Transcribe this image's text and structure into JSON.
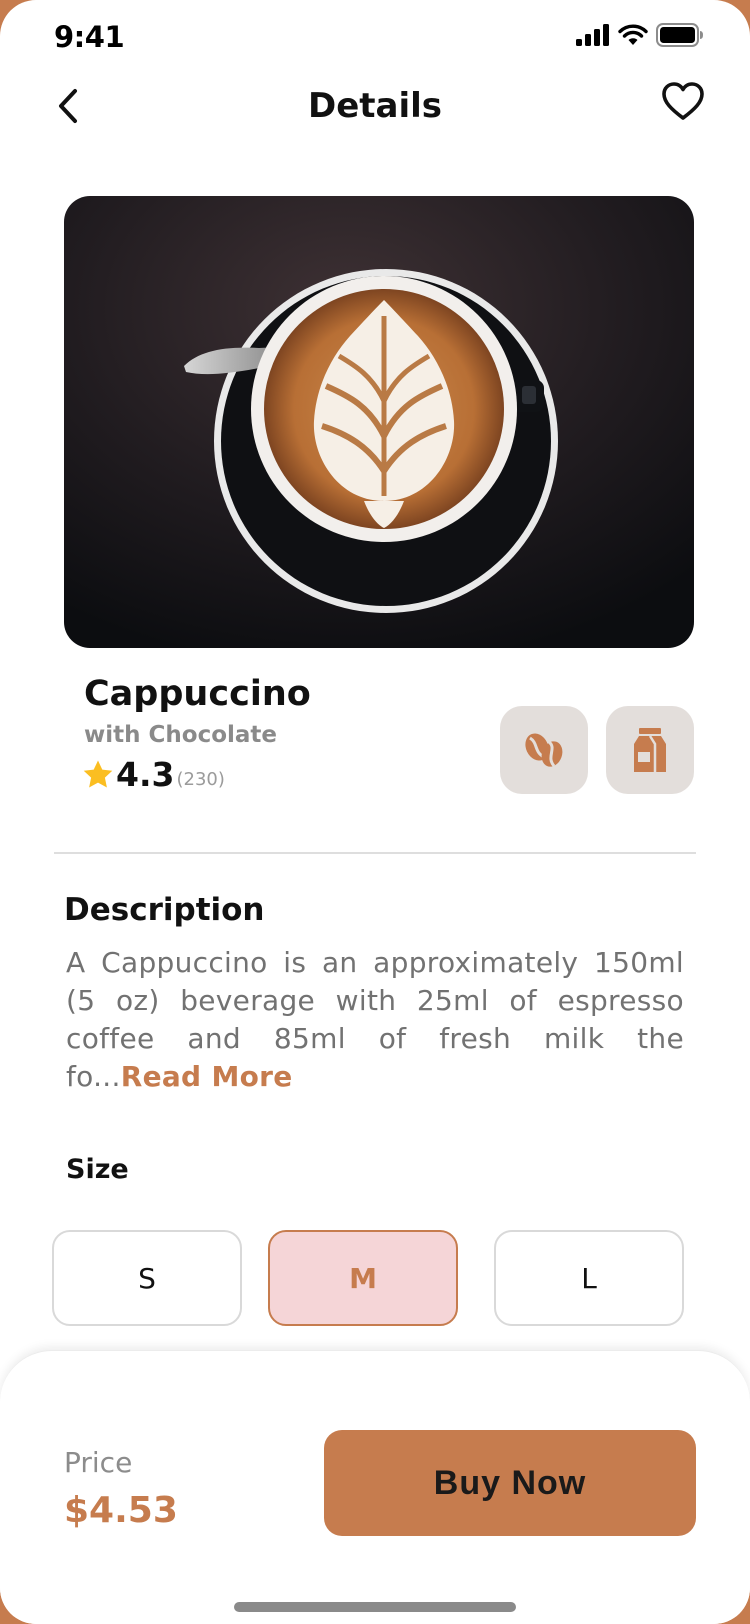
{
  "status_bar": {
    "time": "9:41"
  },
  "header": {
    "title": "Details"
  },
  "product": {
    "name": "Cappuccino",
    "subtitle": "with Chocolate",
    "rating": "4.3",
    "rating_count": "(230)"
  },
  "description": {
    "title": "Description",
    "text": "A Cappuccino is an approximately 150ml (5 oz) beverage with 25ml of espresso coffee and 85ml of fresh milk the fo...",
    "read_more": "Read More"
  },
  "size": {
    "title": "Size",
    "options": [
      "S",
      "M",
      "L"
    ],
    "selected": "M"
  },
  "footer": {
    "price_label": "Price",
    "price": "$4.53",
    "buy_label": "Buy Now"
  },
  "colors": {
    "accent": "#c67c4e",
    "selected_bg": "#f5d5d7",
    "feature_bg": "#e3dedb",
    "star": "#fbbe21"
  },
  "icons": {
    "back": "chevron-left-icon",
    "favorite": "heart-outline-icon",
    "feature_1": "coffee-bean-icon",
    "feature_2": "milk-carton-icon",
    "rating": "star-icon"
  }
}
